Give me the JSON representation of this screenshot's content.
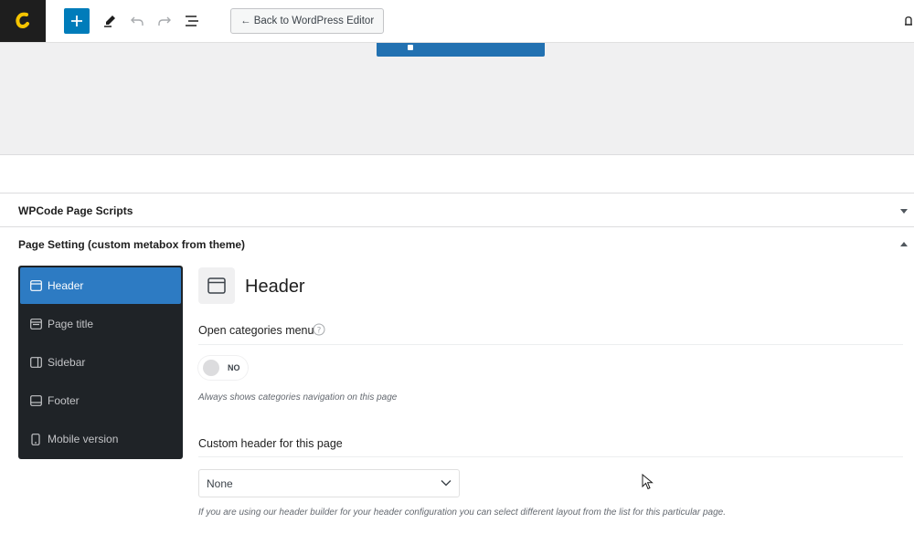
{
  "toolbar": {
    "logo_icon": "cloud-logo-icon",
    "add_icon": "plus-icon",
    "tools_icon": "pencil-icon",
    "undo_icon": "undo-icon",
    "redo_icon": "redo-icon",
    "list_view_icon": "list-view-icon",
    "back_label": "← Back to WordPress Editor",
    "accent_color": "#007cba"
  },
  "metaboxes": [
    {
      "title": "WPCode Page Scripts",
      "state": "collapsed"
    },
    {
      "title": "Page Setting (custom metabox from theme)",
      "state": "expanded"
    }
  ],
  "sidebar": {
    "items": [
      {
        "label": "Header",
        "icon": "header-layout-icon",
        "active": true
      },
      {
        "label": "Page title",
        "icon": "page-title-icon",
        "active": false
      },
      {
        "label": "Sidebar",
        "icon": "sidebar-layout-icon",
        "active": false
      },
      {
        "label": "Footer",
        "icon": "footer-layout-icon",
        "active": false
      },
      {
        "label": "Mobile version",
        "icon": "mobile-icon",
        "active": false
      }
    ],
    "bg_color": "#1f2327",
    "active_color": "#2d7bc3"
  },
  "main": {
    "section_title": "Header",
    "section_icon": "header-layout-icon",
    "fields": {
      "categories_menu": {
        "label": "Open categories menu",
        "toggle_text": "NO",
        "toggle_on": false,
        "help": "Always shows categories navigation on this page"
      },
      "custom_header": {
        "label": "Custom header for this page",
        "selected": "None",
        "help": "If you are using our header builder for your header configuration you can select different layout from the list for this particular page."
      }
    }
  }
}
